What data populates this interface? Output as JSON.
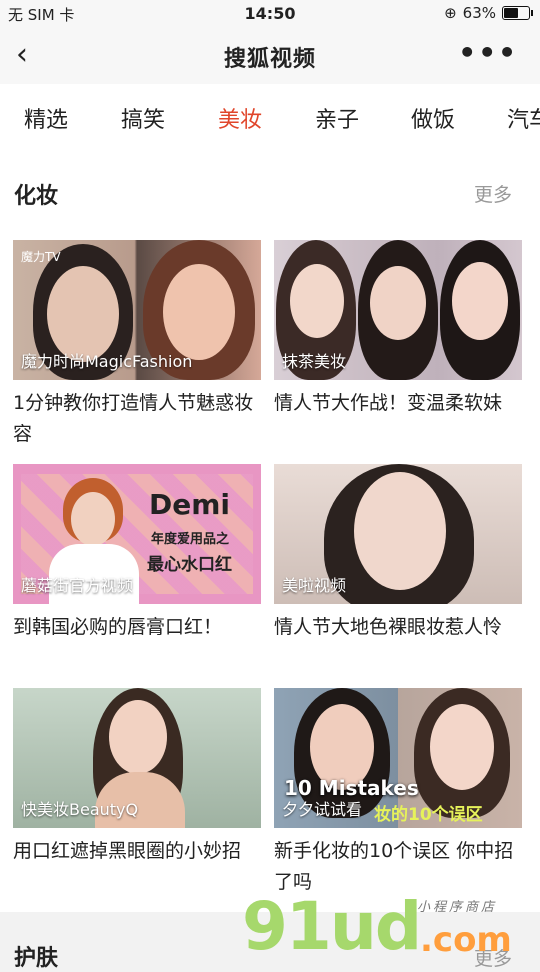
{
  "status_bar": {
    "carrier": "无 SIM 卡",
    "time": "14:50",
    "battery": "63%",
    "battery_level": 0.63
  },
  "nav": {
    "back": "‹",
    "title": "搜狐视频",
    "more": "•••"
  },
  "tabs": [
    {
      "label": "精选"
    },
    {
      "label": "搞笑"
    },
    {
      "label": "美妆"
    },
    {
      "label": "亲子"
    },
    {
      "label": "做饭"
    },
    {
      "label": "汽车"
    }
  ],
  "active_tab": "美妆",
  "colors": {
    "accent": "#e0452a",
    "logo_green": "#a6d86c",
    "logo_orange": "#ff9e3d"
  },
  "section": {
    "title": "化妆",
    "more": "更多"
  },
  "videos": [
    {
      "source": "魔力时尚MagicFashion",
      "caption": "1分钟教你打造情人节魅惑妆容",
      "badge": "魔力TV"
    },
    {
      "source": "抹茶美妆",
      "caption": "情人节大作战！变温柔软妹"
    },
    {
      "source": "蘑菇街官方视频",
      "caption": "到韩国必购的唇膏口红！",
      "overlay1": "Demi",
      "overlay2": "年度爱用品之",
      "overlay3": "最心水口红"
    },
    {
      "source": "美啦视频",
      "caption": "情人节大地色裸眼妆惹人怜"
    },
    {
      "source": "快美妆BeautyQ",
      "caption": "用口红遮掉黑眼圈的小妙招"
    },
    {
      "source": "夕夕试试看",
      "caption": "新手化妆的10个误区 你中招了吗",
      "overlay1": "10 Mistakes",
      "overlay2": "妆的10个误区"
    }
  ],
  "next_section": {
    "title": "护肤",
    "more": "更多"
  },
  "watermark": {
    "main": "91ud",
    "suffix": ".com",
    "note": "小程序商店"
  }
}
